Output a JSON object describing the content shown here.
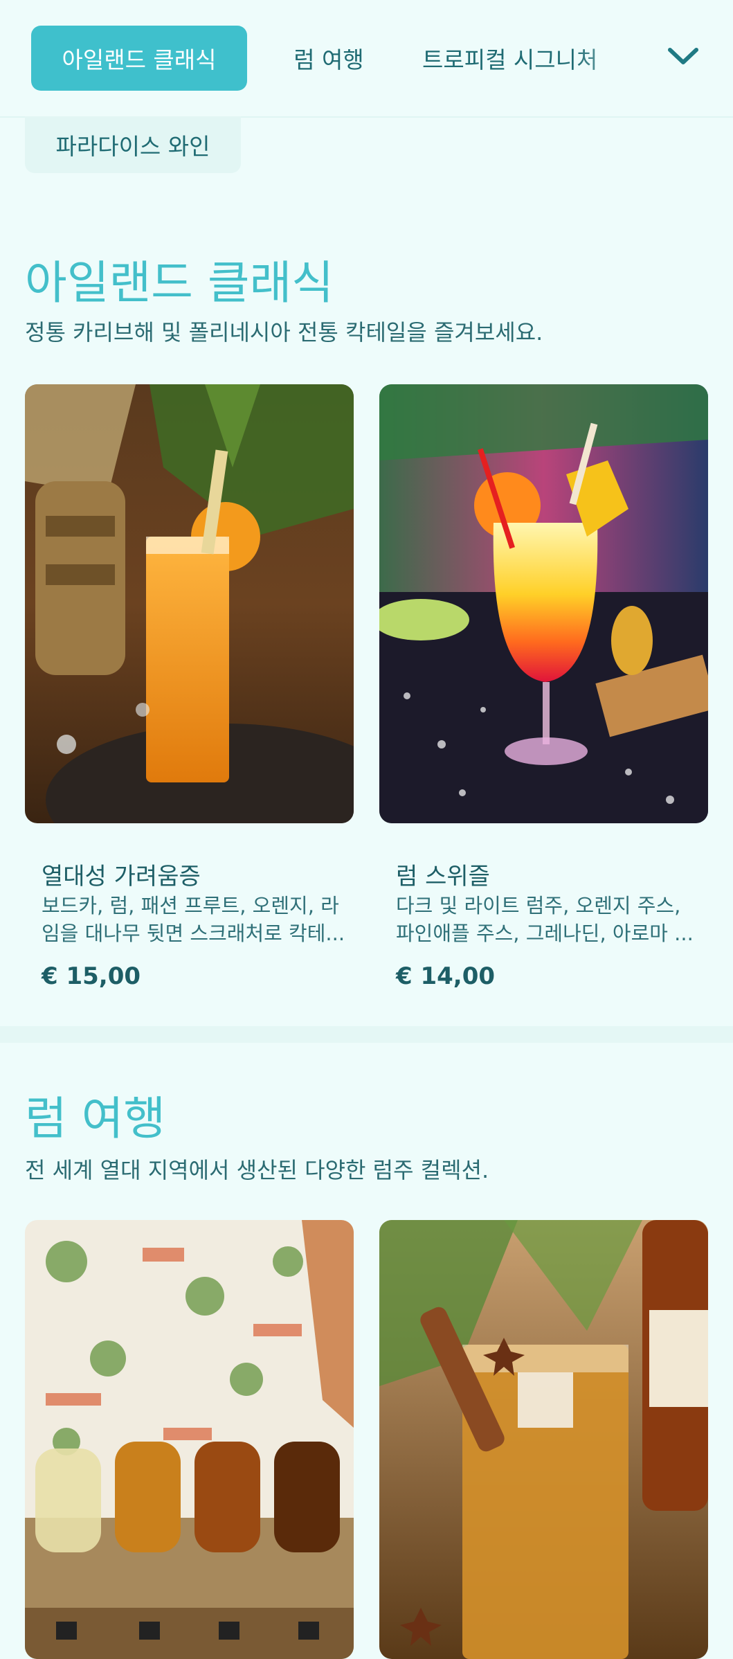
{
  "nav": {
    "tabs": [
      "아일랜드 클래식",
      "럼 여행",
      "트로피컬 시그니처",
      "파라다이스 와인"
    ],
    "active_index": 0,
    "expand_icon": "chevron-down-icon"
  },
  "sections": [
    {
      "title": "아일랜드 클래식",
      "description": "정통 카리브해 및 폴리네시아 전통 칵테일을 즐겨보세요.",
      "items": [
        {
          "name": "열대성 가려움증",
          "description_line1": "보드카, 럼, 패션 프루트, 오렌지, 라",
          "description_line2": "임을 대나무 뒷면 스크래처로 칵테...",
          "price": "€ 15,00",
          "image": "orange-cocktail-photo"
        },
        {
          "name": "럼 스위즐",
          "description_line1": "다크 및 라이트 럼주, 오렌지 주스,",
          "description_line2": "파인애플 주스, 그레나딘, 아로마 ...",
          "price": "€ 14,00",
          "image": "sunrise-cocktail-photo"
        }
      ]
    },
    {
      "title": "럼 여행",
      "description": "전 세계 열대 지역에서 생산된 다양한 럼주 컬렉션.",
      "items": [
        {
          "image": "rum-flight-map-photo"
        },
        {
          "image": "rum-on-ice-photo"
        }
      ]
    }
  ],
  "colors": {
    "background": "#eefcfb",
    "accent": "#43bfca",
    "active_tab": "#3fc0cc",
    "text": "#1f6b73"
  }
}
